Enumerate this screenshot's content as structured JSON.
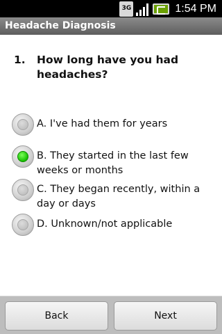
{
  "status_bar": {
    "network_label": "3G",
    "time": "1:54 PM",
    "icons": [
      "3g-data-icon",
      "signal-icon",
      "battery-icon"
    ]
  },
  "window": {
    "title": "Headache Diagnosis"
  },
  "question": {
    "number": "1.",
    "text": "How long have you had headaches?"
  },
  "options": [
    {
      "label": "A.  I've had them for years",
      "selected": false
    },
    {
      "label": "B.  They started in the last few weeks or months",
      "selected": true
    },
    {
      "label": "C.  They began recently, within a day or days",
      "selected": false
    },
    {
      "label": "D.  Unknown/not applicable",
      "selected": false
    }
  ],
  "buttons": {
    "back_label": "Back",
    "next_label": "Next"
  },
  "colors": {
    "selected_radio": "#16c000",
    "title_bar": "#6e6e6e",
    "bottom_bar": "#bdbdbd"
  }
}
